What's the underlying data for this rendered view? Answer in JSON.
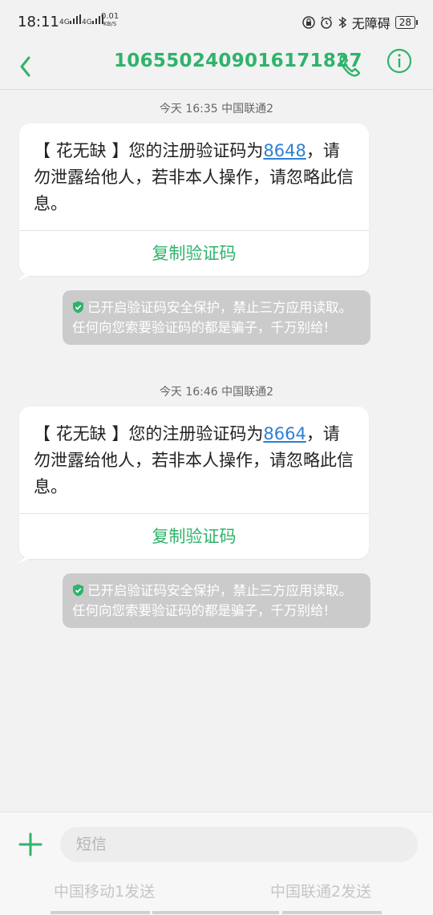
{
  "status_bar": {
    "time": "18:11",
    "signal1": "4G",
    "signal2": "4G",
    "speed_value": "0.01",
    "speed_unit": "KB/S",
    "accessibility": "无障碍",
    "battery": "28"
  },
  "header": {
    "title": "1065502409016171827"
  },
  "messages": [
    {
      "timestamp": "今天 16:35  中国联通2",
      "text_prefix": "【 花无缺 】您的注册验证码为",
      "code": "8648",
      "text_suffix": "，请勿泄露给他人，若非本人操作，请忽略此信息。",
      "copy_label": "复制验证码",
      "notice": "已开启验证码安全保护，禁止三方应用读取。任何向您索要验证码的都是骗子，千万别给!"
    },
    {
      "timestamp": "今天 16:46  中国联通2",
      "text_prefix": "【 花无缺 】您的注册验证码为",
      "code": "8664",
      "text_suffix": "，请勿泄露给他人，若非本人操作，请忽略此信息。",
      "copy_label": "复制验证码",
      "notice": "已开启验证码安全保护，禁止三方应用读取。任何向您索要验证码的都是骗子，千万别给!"
    }
  ],
  "compose": {
    "placeholder": "短信",
    "send_sim1": "中国移动1发送",
    "send_sim2": "中国联通2发送"
  },
  "colors": {
    "accent": "#2fb36b",
    "code_link": "#2d7fd3",
    "notice_bg": "#cbcbcb"
  }
}
